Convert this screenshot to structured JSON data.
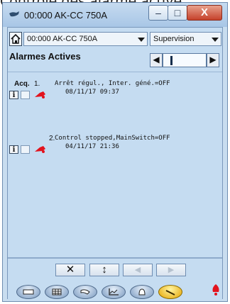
{
  "page_heading": "Contrôle des alarme active",
  "window": {
    "title": "00:000 AK-CC 750A",
    "controls": {
      "minimize": "–",
      "maximize": "□",
      "close": "X"
    }
  },
  "toolbar": {
    "device_select_value": "00:000 AK-CC 750A",
    "mode_select_value": "Supervision",
    "panel_title": "Alarmes Actives"
  },
  "alarm_columns": {
    "acq": "Acq."
  },
  "alarms": [
    {
      "number": "1.",
      "message": "Arrêt régul., Inter. géné.=OFF",
      "timestamp": "08/11/17 09:37"
    },
    {
      "number": "2.",
      "message": "Control stopped,MainSwitch=OFF",
      "timestamp": "04/11/17 21:36"
    }
  ],
  "actions": {
    "clear": "✕",
    "refresh": "↕",
    "previous": "◀",
    "next": "▶"
  },
  "icons": {
    "alarm_color": "#e2131d",
    "active_tab_color": "#f6c33a"
  },
  "tabs": [
    "tab-device",
    "tab-grid",
    "tab-wrench",
    "tab-graph",
    "tab-alarm",
    "tab-active"
  ]
}
